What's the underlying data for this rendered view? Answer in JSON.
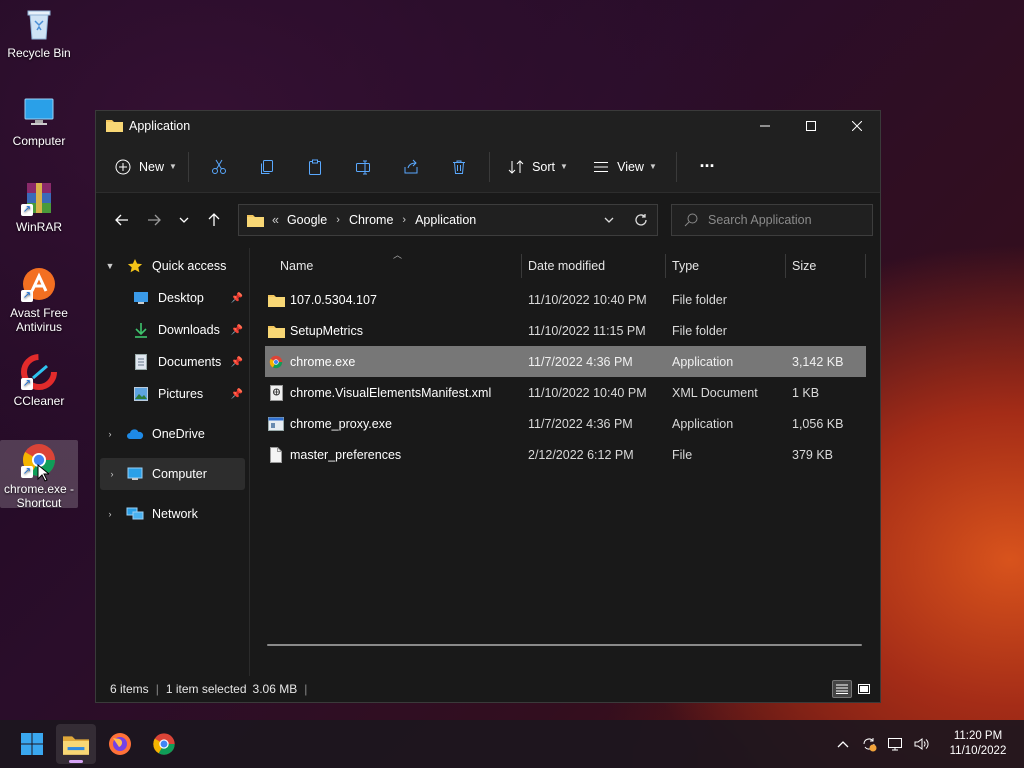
{
  "desktop": {
    "icons": [
      {
        "label": "Recycle Bin"
      },
      {
        "label": "Computer"
      },
      {
        "label": "WinRAR"
      },
      {
        "label": "Avast Free Antivirus"
      },
      {
        "label": "CCleaner"
      },
      {
        "label": "chrome.exe - Shortcut"
      }
    ]
  },
  "window": {
    "title": "Application",
    "toolbar": {
      "new_label": "New",
      "sort_label": "Sort",
      "view_label": "View",
      "more_label": "···"
    },
    "address": {
      "overflow": "«",
      "crumbs": [
        "Google",
        "Chrome",
        "Application"
      ]
    },
    "search": {
      "placeholder": "Search Application"
    },
    "sidebar": {
      "quick_access": "Quick access",
      "pinned": [
        "Desktop",
        "Downloads",
        "Documents",
        "Pictures"
      ],
      "onedrive": "OneDrive",
      "computer": "Computer",
      "network": "Network"
    },
    "columns": {
      "name": "Name",
      "date": "Date modified",
      "type": "Type",
      "size": "Size"
    },
    "files": [
      {
        "name": "107.0.5304.107",
        "date": "11/10/2022 10:40 PM",
        "type": "File folder",
        "size": "",
        "icon": "folder-icon"
      },
      {
        "name": "SetupMetrics",
        "date": "11/10/2022 11:15 PM",
        "type": "File folder",
        "size": "",
        "icon": "folder-icon"
      },
      {
        "name": "chrome.exe",
        "date": "11/7/2022 4:36 PM",
        "type": "Application",
        "size": "3,142 KB",
        "icon": "chrome-icon"
      },
      {
        "name": "chrome.VisualElementsManifest.xml",
        "date": "11/10/2022 10:40 PM",
        "type": "XML Document",
        "size": "1 KB",
        "icon": "xml-file-icon"
      },
      {
        "name": "chrome_proxy.exe",
        "date": "11/7/2022 4:36 PM",
        "type": "Application",
        "size": "1,056 KB",
        "icon": "application-icon"
      },
      {
        "name": "master_preferences",
        "date": "2/12/2022 6:12 PM",
        "type": "File",
        "size": "379 KB",
        "icon": "file-icon"
      }
    ],
    "status": {
      "count": "6 items",
      "selected": "1 item selected",
      "size": "3.06 MB"
    }
  },
  "taskbar": {
    "time": "11:20 PM",
    "date": "11/10/2022"
  },
  "colors": {
    "accent": "#0078d4",
    "folder": "#f2c55c",
    "selected_row": "#777777"
  }
}
